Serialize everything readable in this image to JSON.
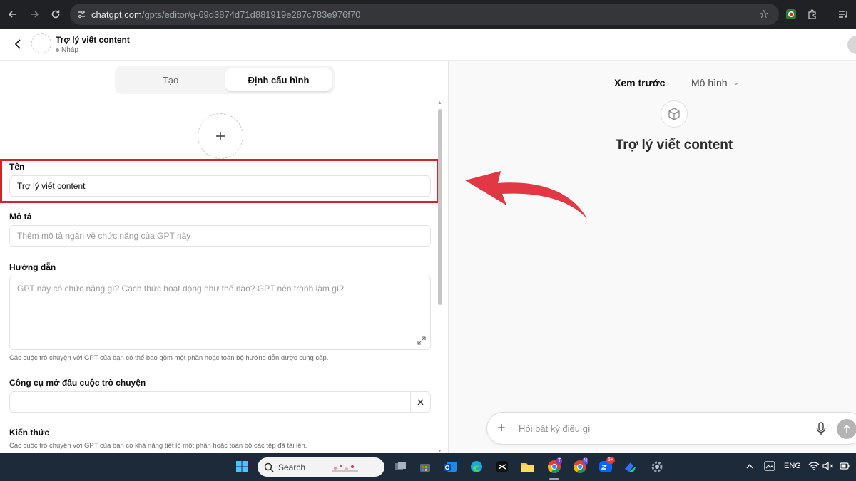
{
  "browser": {
    "url_host": "chatgpt.com",
    "url_path": "/gpts/editor/g-69d3874d71d881919e287c783e976f70",
    "icons": [
      "back-arrow-icon",
      "forward-arrow-icon",
      "reload-icon",
      "site-settings-icon",
      "bookmark-star-icon",
      "extensions-icon",
      "media-controls-icon"
    ]
  },
  "header": {
    "gpt_name": "Trợ lý viết content",
    "status": "Nháp"
  },
  "editor": {
    "tabs": [
      {
        "label": "Tạo",
        "active": false
      },
      {
        "label": "Định cấu hình",
        "active": true
      }
    ],
    "name_label": "Tên",
    "name_value": "Trợ lý viết content",
    "description_label": "Mô tả",
    "description_placeholder": "Thêm mô tả ngắn về chức năng của GPT này",
    "instructions_label": "Hướng dẫn",
    "instructions_placeholder": "GPT này có chức năng gì? Cách thức hoạt động như thế nào? GPT nên tránh làm gì?",
    "instructions_hint": "Các cuộc trò chuyện với GPT của bạn có thể bao gồm một phần hoặc toàn bộ hướng dẫn được cung cấp.",
    "starters_label": "Công cụ mở đầu cuộc trò chuyện",
    "starters_value": "",
    "knowledge_label": "Kiến thức",
    "knowledge_hint": "Các cuộc trò chuyện với GPT của bạn có khả năng tiết lộ một phần hoặc toàn bộ các tệp đã tải lên."
  },
  "preview": {
    "label": "Xem trước",
    "model_label": "Mô hình",
    "gpt_title": "Trợ lý viết content",
    "composer_placeholder": "Hỏi bất kỳ điều gì"
  },
  "taskbar": {
    "search_label": "Search",
    "language": "ENG",
    "badges": {
      "chrome_t": "T",
      "chrome_n": "N",
      "zalo": "5+"
    }
  },
  "colors": {
    "highlight": "#d5232d",
    "taskbar": "#1c2a3a",
    "browser": "#202124"
  }
}
